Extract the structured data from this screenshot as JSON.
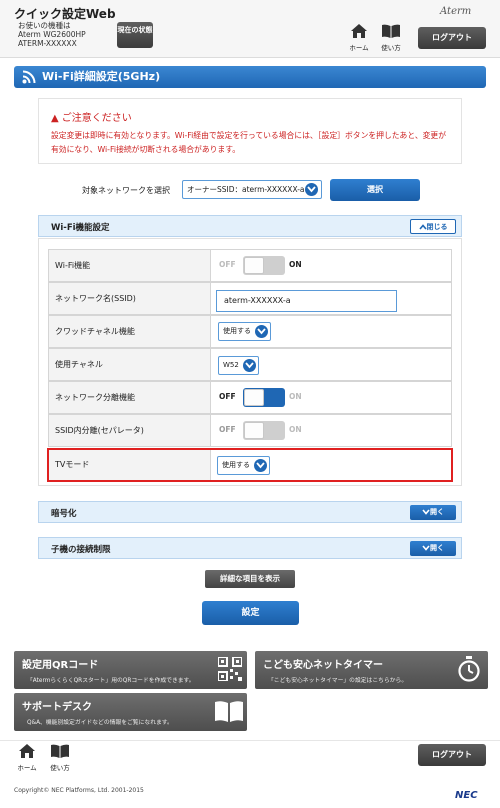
{
  "header": {
    "app_title": "クイック設定Web",
    "device_caption": "お使いの機種は",
    "device_model": "Aterm WG2600HP",
    "device_ssid": "ATERM-XXXXXX",
    "status_button": "現在の状態",
    "brand": "Aterm",
    "home_label": "ホーム",
    "help_label": "使い方",
    "logout_label": "ログアウト"
  },
  "page_title": "Wi-Fi詳細設定(5GHz)",
  "caution": {
    "title": "ご注意ください",
    "text": "設定変更は即時に有効となります。Wi-Fi経由で設定を行っている場合には、［設定］ボタンを押したあと、変更が有効になり、Wi-Fi接続が切断される場合があります。"
  },
  "network_select": {
    "label": "対象ネットワークを選択",
    "value": "オーナーSSID：aterm-XXXXXX-a",
    "button": "選択"
  },
  "wifi_section": {
    "title": "Wi-Fi機能設定",
    "toggle_label": "閉じる",
    "rows": {
      "wifi_function": {
        "label": "Wi-Fi機能",
        "off": "OFF",
        "on": "ON",
        "state": "on",
        "disabled": true
      },
      "ssid": {
        "label": "ネットワーク名(SSID)",
        "value": "aterm-XXXXXX-a"
      },
      "cloud_channel": {
        "label": "クワッドチャネル機能",
        "value": "使用する"
      },
      "channel": {
        "label": "使用チャネル",
        "value": "W52"
      },
      "network_separation": {
        "label": "ネットワーク分離機能",
        "off": "OFF",
        "on": "ON",
        "state": "off"
      },
      "ssid_separator": {
        "label": "SSID内分離(セパレータ)",
        "off": "OFF",
        "on": "ON",
        "state": "off",
        "disabled": true
      },
      "tv_mode": {
        "label": "TVモード",
        "value": "使用する"
      }
    }
  },
  "encryption_section": {
    "title": "暗号化",
    "toggle_label": "開く"
  },
  "child_section": {
    "title": "子機の接続制限",
    "toggle_label": "開く"
  },
  "detail_button": "詳細な項目を表示",
  "apply_button": "設定",
  "panels": {
    "qr": {
      "title": "設定用QRコード",
      "desc": "「AtermらくらくQRスタート」用のQRコードを作成できます。"
    },
    "timer": {
      "title": "こども安心ネットタイマー",
      "desc": "「こども安心ネットタイマー」の設定はこちらから。"
    },
    "support": {
      "title": "サポートデスク",
      "desc": "Q&A、機能別設定ガイドなどの情報をご覧になれます。"
    }
  },
  "footer": {
    "home_label": "ホーム",
    "help_label": "使い方",
    "logout_label": "ログアウト",
    "copyright": "Copyright© NEC Platforms, Ltd. 2001-2015",
    "logo": "NEC"
  },
  "colors": {
    "accent": "#1f67b4",
    "warning": "#cc2222",
    "highlight": "#e02020"
  }
}
